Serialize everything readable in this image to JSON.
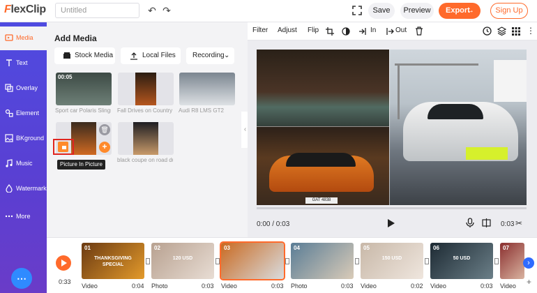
{
  "app": {
    "logo": "FlexClip",
    "logo_first": "F",
    "logo_rest": "lexClip"
  },
  "header": {
    "title_placeholder": "Untitled",
    "save_label": "Save",
    "preview_label": "Preview",
    "export_label": "Export",
    "export_arrow": "→",
    "signup_label": "Sign Up"
  },
  "sidebar": {
    "items": [
      {
        "label": "Media",
        "icon": "media-icon",
        "active": true
      },
      {
        "label": "Text",
        "icon": "text-icon"
      },
      {
        "label": "Overlay",
        "icon": "overlay-icon"
      },
      {
        "label": "Element",
        "icon": "element-icon"
      },
      {
        "label": "BKground",
        "icon": "background-icon"
      },
      {
        "label": "Music",
        "icon": "music-icon"
      },
      {
        "label": "Watermark",
        "icon": "watermark-icon"
      },
      {
        "label": "More",
        "icon": "more-icon"
      }
    ],
    "help_icon": "chat-help-icon"
  },
  "media": {
    "heading": "Add Media",
    "buttons": {
      "stock": "Stock Media",
      "local": "Local Files",
      "recording": "Recording"
    },
    "items": [
      {
        "label": "Sport car Polaris Slingsh...",
        "duration": "00:05",
        "colors": [
          "#3d4a45",
          "#6e8077"
        ]
      },
      {
        "label": "Fall Drives on Country R...",
        "colors": [
          "#2b1d12",
          "#b5561e"
        ]
      },
      {
        "label": "Audi R8 LMS GT2",
        "colors": [
          "#7b8590",
          "#dde1e4"
        ]
      },
      {
        "label": "",
        "colors": [
          "#3a2a1e",
          "#d06a22"
        ]
      },
      {
        "label": "black coupe on road duri...",
        "colors": [
          "#1e1e22",
          "#c89a6a"
        ]
      }
    ],
    "tooltip": "Picture In Picture"
  },
  "edit_toolbar": {
    "filter": "Filter",
    "adjust": "Adjust",
    "flip": "Flip",
    "in_label": "In",
    "out_label": "Out"
  },
  "player": {
    "time_current": "0:00 / 0:03",
    "time_total": "0:03"
  },
  "timeline": {
    "time": "0:33",
    "clips": [
      {
        "num": "01",
        "type": "Video",
        "dur": "0:04",
        "overlay": "THANKSGIVING SPECIAL",
        "colors": [
          "#6b3a12",
          "#e39a2b"
        ]
      },
      {
        "num": "02",
        "type": "Photo",
        "dur": "0:03",
        "overlay": "120 USD",
        "colors": [
          "#b8a190",
          "#e8ddd4"
        ]
      },
      {
        "num": "03",
        "type": "Video",
        "dur": "0:03",
        "overlay": "",
        "colors": [
          "#c96a22",
          "#d9dcdf"
        ],
        "selected": true
      },
      {
        "num": "04",
        "type": "Photo",
        "dur": "0:03",
        "overlay": "",
        "colors": [
          "#5a7d96",
          "#d9cbb8"
        ]
      },
      {
        "num": "05",
        "type": "Video",
        "dur": "0:02",
        "overlay": "150 USD",
        "colors": [
          "#c8b8a8",
          "#efe6de"
        ]
      },
      {
        "num": "06",
        "type": "Video",
        "dur": "0:03",
        "overlay": "50 USD",
        "colors": [
          "#1d2a33",
          "#6b7f88"
        ]
      },
      {
        "num": "07",
        "type": "Video",
        "dur": "",
        "overlay": "",
        "colors": [
          "#8a2f2f",
          "#d9b3a0"
        ]
      }
    ],
    "next_icon": "chevron-right-icon",
    "add_icon": "plus-icon"
  },
  "colors": {
    "accent": "#ff6a2b",
    "sidebar": "#5347dc",
    "blue": "#2f6bff"
  }
}
